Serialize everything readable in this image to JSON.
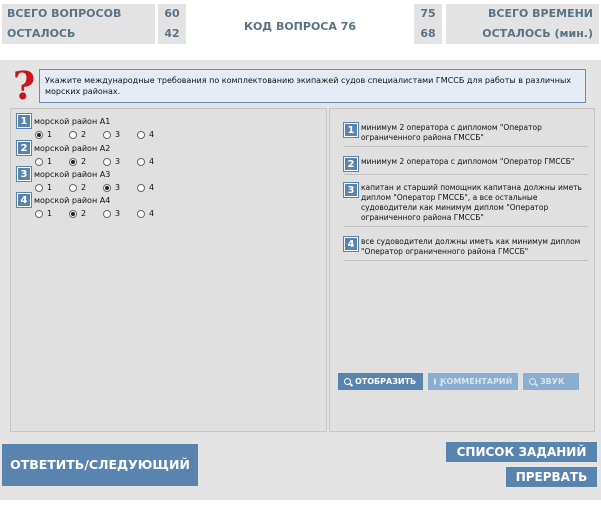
{
  "header": {
    "total_questions_label": "ВСЕГО ВОПРОСОВ",
    "total_questions_value": "60",
    "remaining_label": "ОСТАЛОСЬ",
    "remaining_value": "42",
    "question_code": "КОД ВОПРОСА 76",
    "total_time_label": "ВСЕГО ВРЕМЕНИ (мин.)",
    "total_time_value": "75",
    "remaining_time_label": "ОСТАЛОСЬ (мин.)",
    "remaining_time_value": "68"
  },
  "question": {
    "icon": "question-mark-icon",
    "text": "Укажите международные требования по комплектованию экипажей судов специалистами ГМССБ для работы в различных морских районах."
  },
  "items": [
    {
      "num": "1",
      "label": "морской район А1",
      "selected": 1
    },
    {
      "num": "2",
      "label": "морской район А2",
      "selected": 2
    },
    {
      "num": "3",
      "label": "морской район А3",
      "selected": 3
    },
    {
      "num": "4",
      "label": "морской район А4",
      "selected": 2
    }
  ],
  "option_labels": [
    "1",
    "2",
    "3",
    "4"
  ],
  "answers": [
    {
      "num": "1",
      "text": "минимум 2 оператора с дипломом \"Оператор ограниченного района ГМССБ\""
    },
    {
      "num": "2",
      "text": "минимум 2 оператора с дипломом \"Оператор ГМССБ\""
    },
    {
      "num": "3",
      "text": "капитан и старший помощник капитана должны иметь диплом \"Оператор ГМССБ\", а все остальные судоводители как минимум диплом \"Оператор ограниченного района ГМССБ\""
    },
    {
      "num": "4",
      "text": "все судоводители должны иметь как минимум диплом \"Оператор ограниченного района ГМССБ\""
    }
  ],
  "buttons": {
    "show": "ОТОБРАЗИТЬ",
    "comment": "КОММЕНТАРИЙ",
    "sound": "ЗВУК",
    "answer_next": "ОТВЕТИТЬ/СЛЕДУЮЩИЙ",
    "task_list": "СПИСОК ЗАДАНИЙ",
    "abort": "ПРЕРВАТЬ"
  },
  "colors": {
    "accent": "#5a84b0",
    "header_text": "#5a7384",
    "question_mark": "#c8141c"
  }
}
